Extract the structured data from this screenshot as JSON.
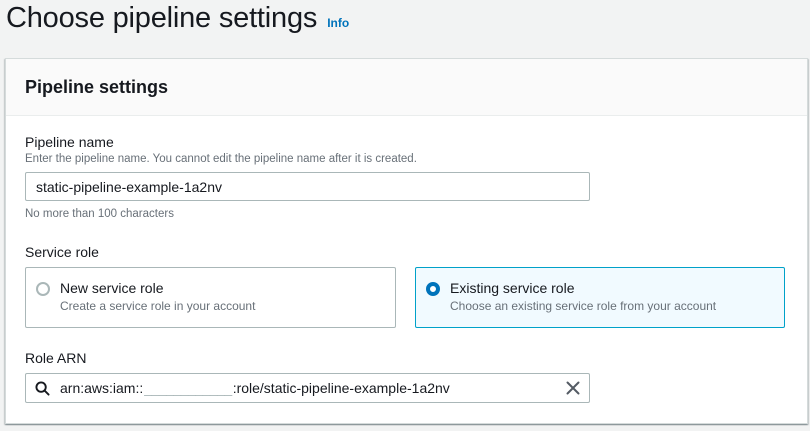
{
  "page": {
    "title": "Choose pipeline settings",
    "info_link": "Info"
  },
  "panel": {
    "title": "Pipeline settings"
  },
  "pipeline_name": {
    "label": "Pipeline name",
    "description": "Enter the pipeline name. You cannot edit the pipeline name after it is created.",
    "value": "static-pipeline-example-1a2nv",
    "constraint": "No more than 100 characters"
  },
  "service_role": {
    "label": "Service role",
    "options": [
      {
        "title": "New service role",
        "description": "Create a service role in your account",
        "selected": false
      },
      {
        "title": "Existing service role",
        "description": "Choose an existing service role from your account",
        "selected": true
      }
    ]
  },
  "role_arn": {
    "label": "Role ARN",
    "prefix": "arn:aws:iam::",
    "masked_account": "____________",
    "suffix": ":role/static-pipeline-example-1a2nv"
  },
  "icons": {
    "search": "search-icon",
    "clear": "close-icon"
  },
  "colors": {
    "accent": "#0073bb",
    "selected_tile_bg": "#f1faff",
    "selected_tile_border": "#00a1c9",
    "page_bg": "#f2f3f3"
  }
}
